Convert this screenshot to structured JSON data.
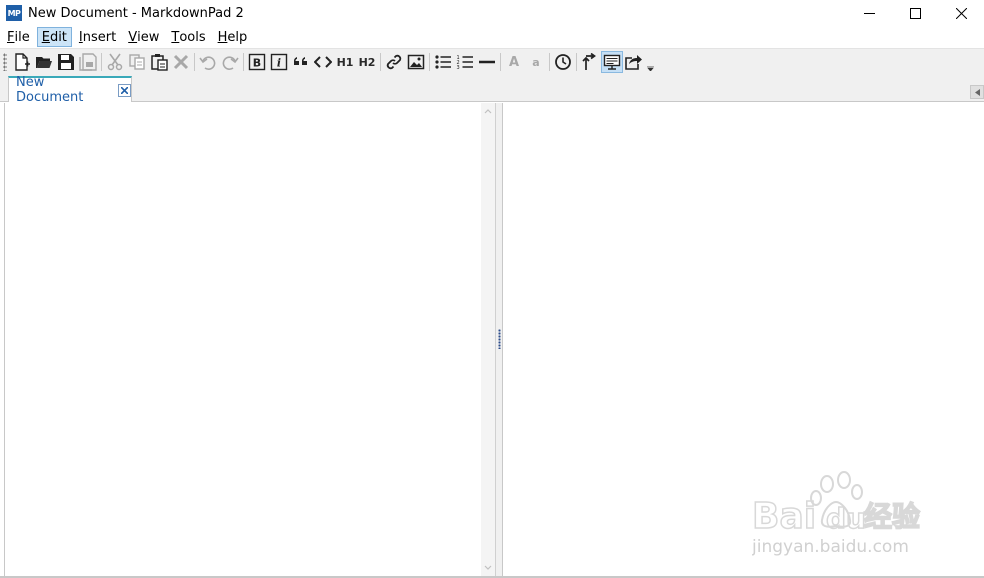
{
  "window": {
    "app_icon_text": "MP",
    "title": "New Document - MarkdownPad 2"
  },
  "menu": {
    "items": [
      {
        "pre": "",
        "key": "F",
        "post": "ile"
      },
      {
        "pre": "",
        "key": "E",
        "post": "dit"
      },
      {
        "pre": "",
        "key": "I",
        "post": "nsert"
      },
      {
        "pre": "",
        "key": "V",
        "post": "iew"
      },
      {
        "pre": "",
        "key": "T",
        "post": "ools"
      },
      {
        "pre": "",
        "key": "H",
        "post": "elp"
      }
    ],
    "active_index": 1
  },
  "toolbar": {
    "h1_label": "H1",
    "h2_label": "H2",
    "font_large_label": "A",
    "font_small_label": "a"
  },
  "tabs": {
    "active_label": "New Document"
  },
  "watermark": {
    "brand": "Bai",
    "brand2": "du",
    "cn": "经验",
    "url": "jingyan.baidu.com"
  },
  "colors": {
    "accent": "#1f5fa8",
    "tab_accent": "#3aa9b9",
    "menu_highlight": "#cce4f7"
  }
}
